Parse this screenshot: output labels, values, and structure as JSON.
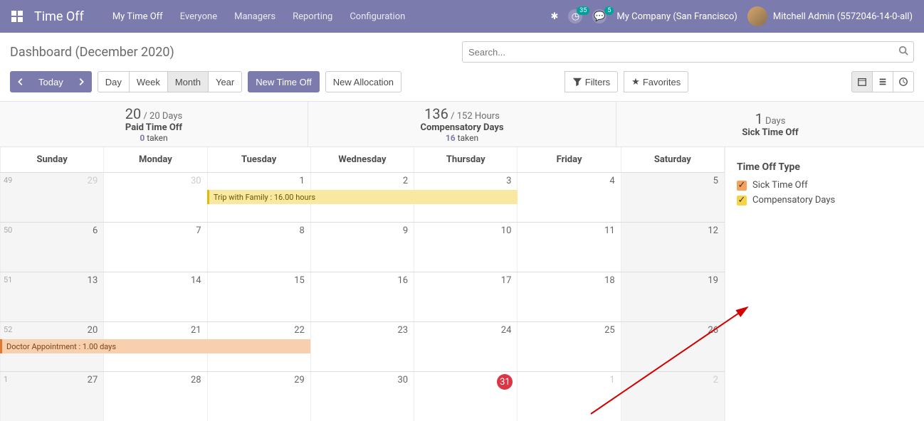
{
  "topbar": {
    "brand": "Time Off",
    "nav": [
      "My Time Off",
      "Everyone",
      "Managers",
      "Reporting",
      "Configuration"
    ],
    "badge1": "35",
    "badge2": "5",
    "company": "My Company (San Francisco)",
    "user": "Mitchell Admin (5572046-14-0-all)"
  },
  "page": {
    "title": "Dashboard (December 2020)",
    "search_placeholder": "Search...",
    "today": "Today",
    "views": [
      "Day",
      "Week",
      "Month",
      "Year"
    ],
    "active_view_index": 2,
    "new_time_off": "New Time Off",
    "new_allocation": "New Allocation",
    "filters": "Filters",
    "favorites": "Favorites"
  },
  "summary": [
    {
      "big": "20",
      "rest": " / 20 Days",
      "name": "Paid Time Off",
      "taken_num": "0",
      "taken_label": " taken"
    },
    {
      "big": "136",
      "rest": " / 152 Hours",
      "name": "Compensatory Days",
      "taken_num": "16",
      "taken_label": " taken"
    },
    {
      "big": "1",
      "rest": " Days",
      "name": "Sick Time Off",
      "taken_num": "",
      "taken_label": ""
    }
  ],
  "calendar": {
    "day_headers": [
      "Sunday",
      "Monday",
      "Tuesday",
      "Wednesday",
      "Thursday",
      "Friday",
      "Saturday"
    ],
    "weeks": [
      {
        "num": "49",
        "days": [
          {
            "d": "29",
            "other": true,
            "we": true
          },
          {
            "d": "30",
            "other": true
          },
          {
            "d": "1"
          },
          {
            "d": "2"
          },
          {
            "d": "3"
          },
          {
            "d": "4"
          },
          {
            "d": "5",
            "we": true
          }
        ],
        "events": [
          {
            "text": "Trip with Family : 16.00 hours",
            "color": "yellow",
            "start": 2,
            "span": 3
          }
        ]
      },
      {
        "num": "50",
        "days": [
          {
            "d": "6",
            "we": true
          },
          {
            "d": "7"
          },
          {
            "d": "8"
          },
          {
            "d": "9"
          },
          {
            "d": "10"
          },
          {
            "d": "11"
          },
          {
            "d": "12",
            "we": true
          }
        ],
        "events": []
      },
      {
        "num": "51",
        "days": [
          {
            "d": "13",
            "we": true
          },
          {
            "d": "14"
          },
          {
            "d": "15"
          },
          {
            "d": "16"
          },
          {
            "d": "17"
          },
          {
            "d": "18"
          },
          {
            "d": "19",
            "we": true
          }
        ],
        "events": []
      },
      {
        "num": "52",
        "days": [
          {
            "d": "20",
            "we": true
          },
          {
            "d": "21"
          },
          {
            "d": "22"
          },
          {
            "d": "23"
          },
          {
            "d": "24"
          },
          {
            "d": "25"
          },
          {
            "d": "26",
            "we": true
          }
        ],
        "events": [
          {
            "text": "Doctor Appointment : 1.00 days",
            "color": "orange",
            "start": 0,
            "span": 3
          }
        ]
      },
      {
        "num": "1",
        "days": [
          {
            "d": "27",
            "we": true
          },
          {
            "d": "28"
          },
          {
            "d": "29"
          },
          {
            "d": "30"
          },
          {
            "d": "31",
            "today": true
          },
          {
            "d": "1",
            "other": true
          },
          {
            "d": "2",
            "other": true,
            "we": true
          }
        ],
        "events": []
      }
    ]
  },
  "sidepanel": {
    "title": "Time Off Type",
    "items": [
      {
        "label": "Sick Time Off",
        "color": "orange"
      },
      {
        "label": "Compensatory Days",
        "color": "yellow"
      }
    ]
  }
}
